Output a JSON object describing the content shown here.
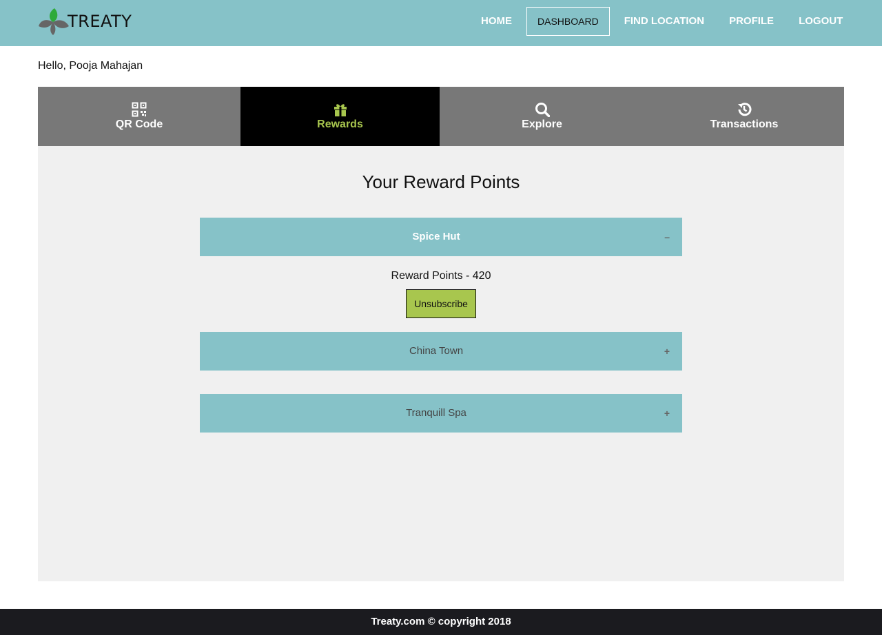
{
  "brand": {
    "name": "TREATY",
    "colors": {
      "primary": "#86c2c8",
      "accent": "#a8c64e",
      "leaf_green": "#2eaa3a",
      "leaf_grey": "#666666"
    }
  },
  "nav": {
    "home": "HOME",
    "dashboard": "DASHBOARD",
    "find_location": "FIND LOCATION",
    "profile": "PROFILE",
    "logout": "LOGOUT",
    "active": "DASHBOARD"
  },
  "greeting": "Hello, Pooja Mahajan",
  "tabs": [
    {
      "label": "QR Code",
      "icon": "qr-code-icon",
      "active": false
    },
    {
      "label": "Rewards",
      "icon": "gift-icon",
      "active": true
    },
    {
      "label": "Explore",
      "icon": "search-icon",
      "active": false
    },
    {
      "label": "Transactions",
      "icon": "history-icon",
      "active": false
    }
  ],
  "rewards": {
    "title": "Your Reward Points",
    "merchants": [
      {
        "name": "Spice Hut",
        "expanded": true,
        "toggle": "–",
        "points_text": "Reward Points - 420",
        "action": "Unsubscribe"
      },
      {
        "name": "China Town",
        "expanded": false,
        "toggle": "+"
      },
      {
        "name": "Tranquill Spa",
        "expanded": false,
        "toggle": "+"
      }
    ]
  },
  "footer": "Treaty.com © copyright 2018"
}
